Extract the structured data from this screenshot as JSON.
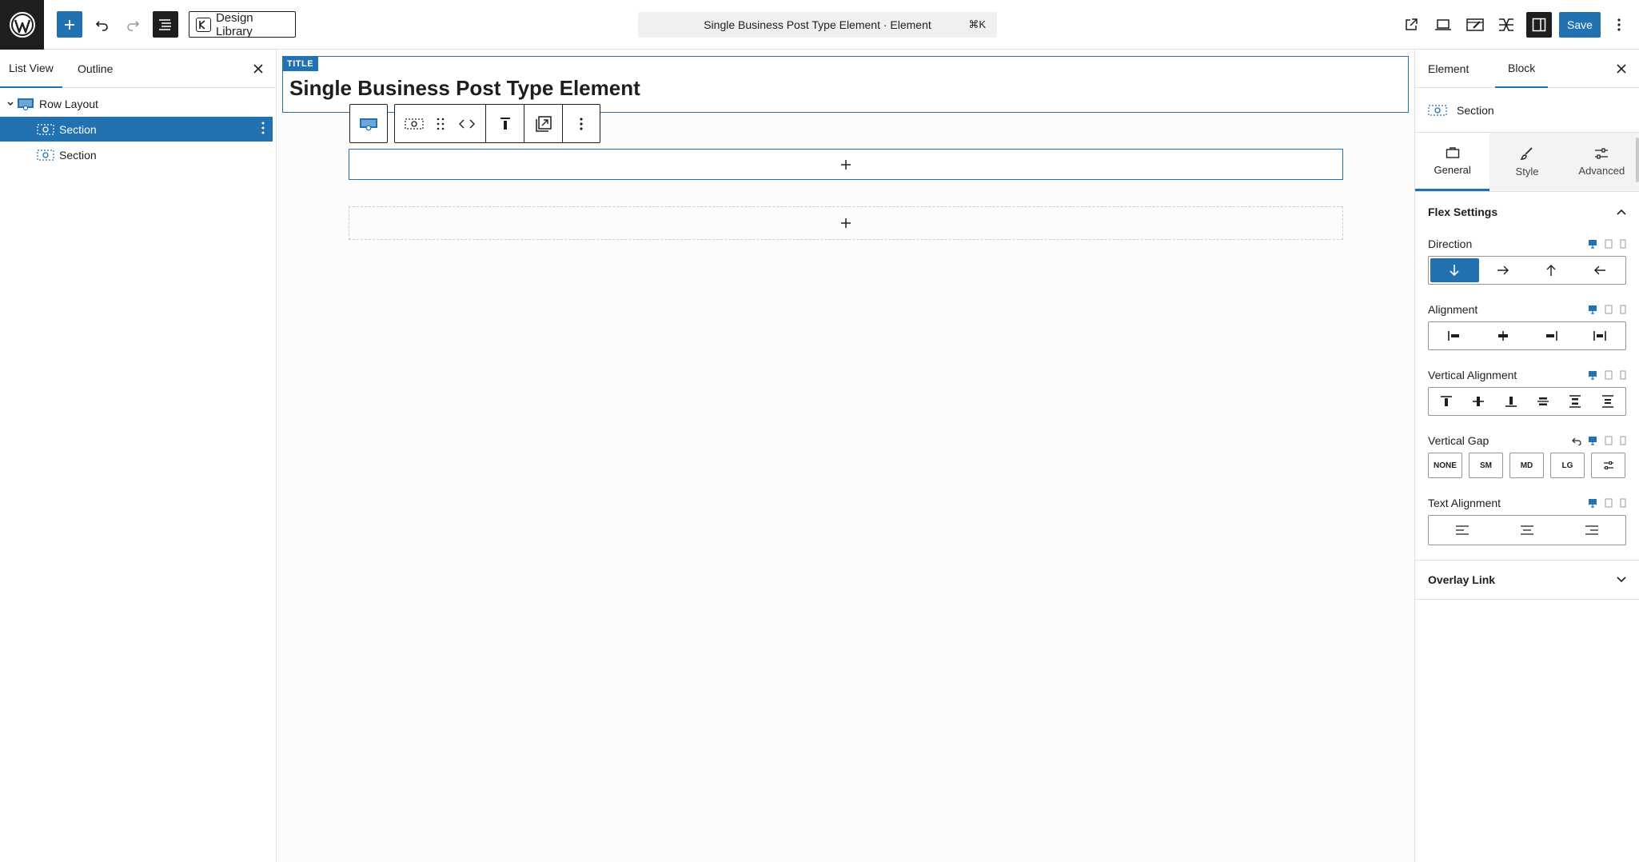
{
  "topbar": {
    "design_library_label": "Design Library",
    "command_title": "Single Business Post Type Element · Element",
    "command_shortcut": "⌘K",
    "save_label": "Save"
  },
  "left_panel": {
    "tabs": [
      {
        "label": "List View"
      },
      {
        "label": "Outline"
      }
    ],
    "tree": [
      {
        "label": "Row Layout"
      },
      {
        "label": "Section"
      },
      {
        "label": "Section"
      }
    ]
  },
  "canvas": {
    "title_badge": "TITLE",
    "title_text": "Single Business Post Type Element"
  },
  "right_panel": {
    "tabs": [
      {
        "label": "Element"
      },
      {
        "label": "Block"
      }
    ],
    "block_name": "Section",
    "subtabs": [
      {
        "label": "General"
      },
      {
        "label": "Style"
      },
      {
        "label": "Advanced"
      }
    ],
    "flex_settings": {
      "title": "Flex Settings",
      "direction_label": "Direction",
      "alignment_label": "Alignment",
      "vertical_alignment_label": "Vertical Alignment",
      "vertical_gap_label": "Vertical Gap",
      "gap_options": [
        "NONE",
        "SM",
        "MD",
        "LG"
      ],
      "text_alignment_label": "Text Alignment"
    },
    "overlay_link_title": "Overlay Link"
  },
  "colors": {
    "accent": "#2271b1",
    "dark": "#1e1e1e"
  }
}
